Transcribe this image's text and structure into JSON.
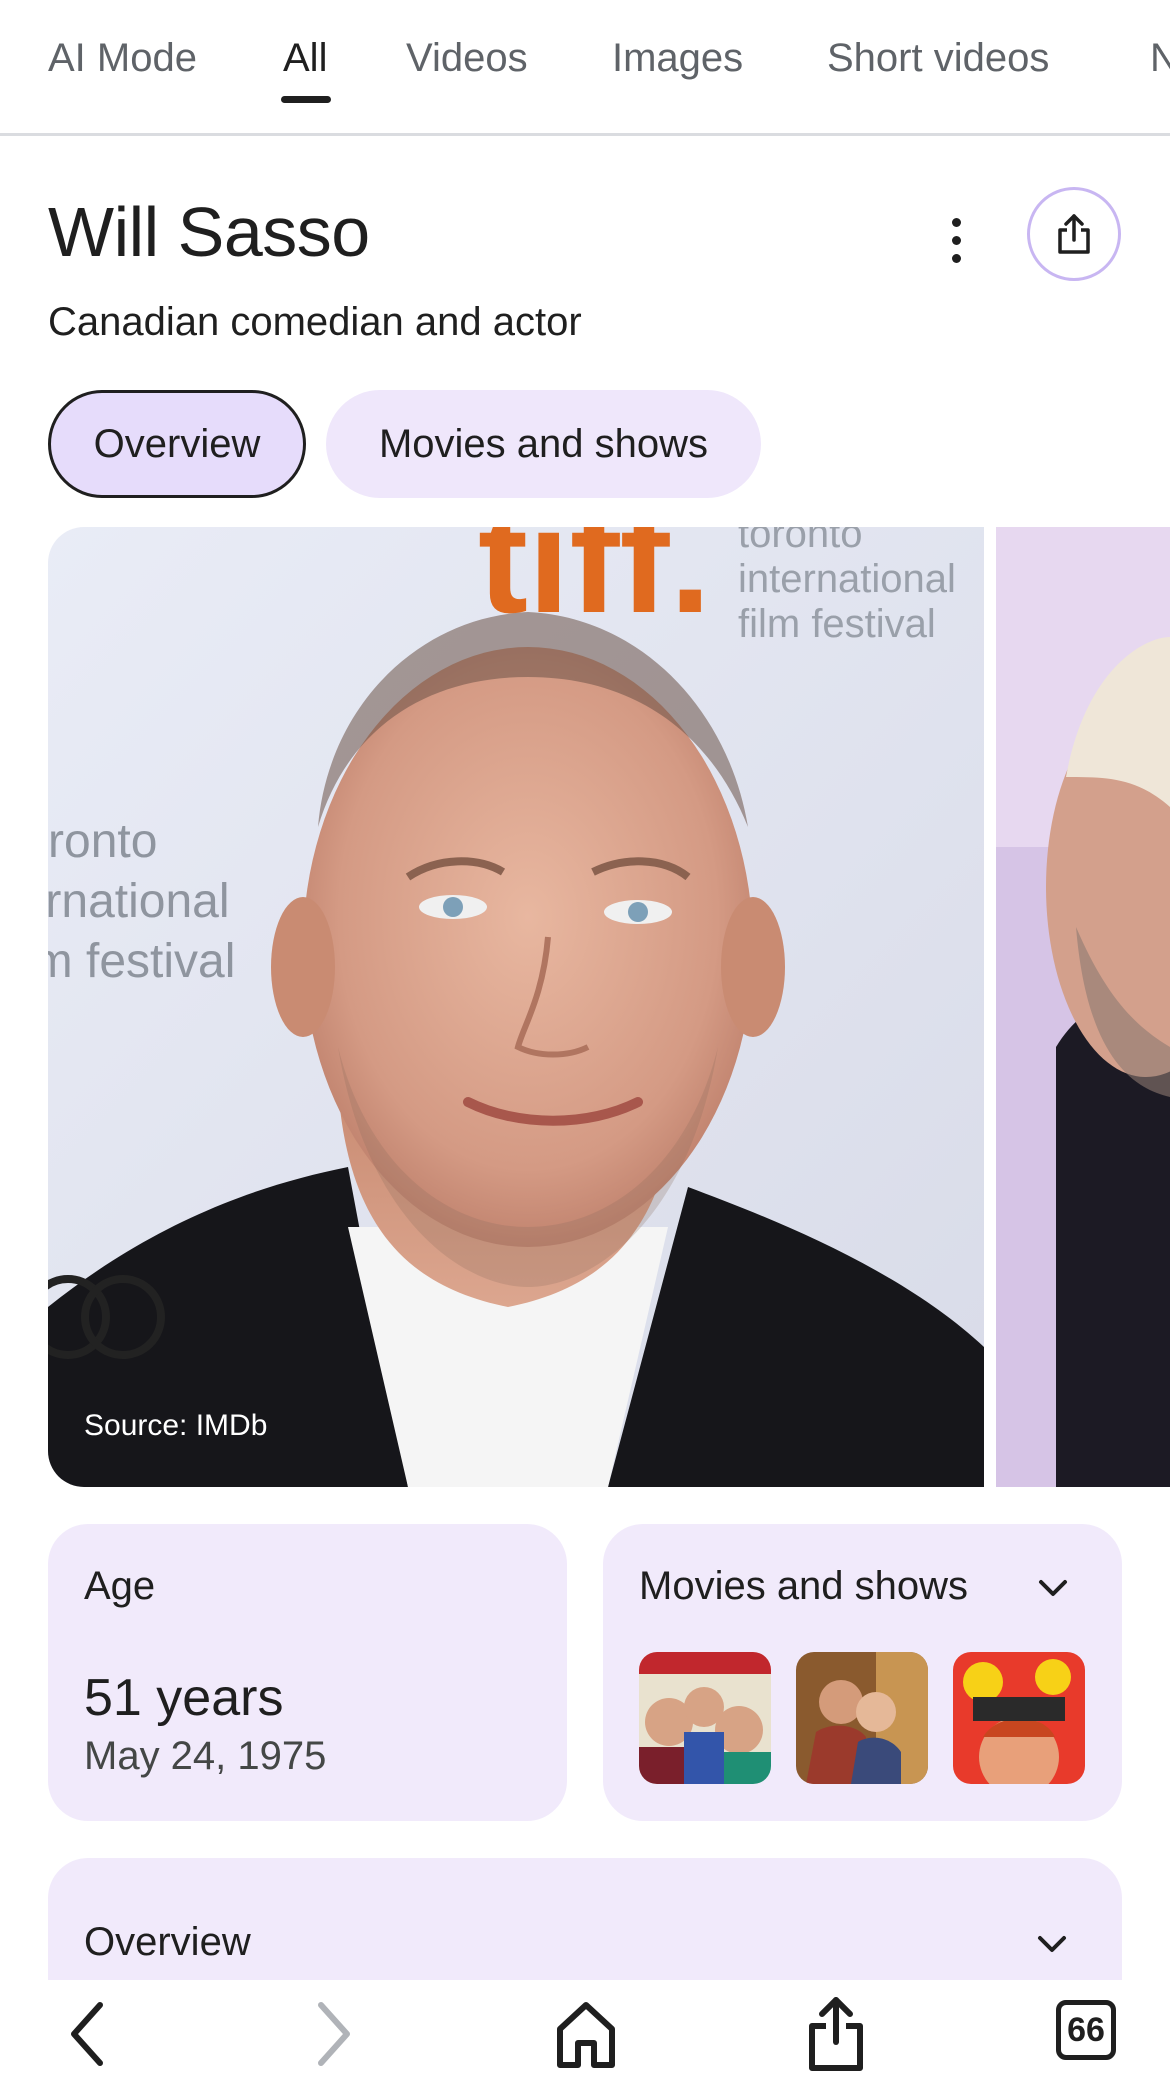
{
  "tabs": [
    {
      "label": "AI Mode",
      "active": false
    },
    {
      "label": "All",
      "active": true
    },
    {
      "label": "Videos",
      "active": false
    },
    {
      "label": "Images",
      "active": false
    },
    {
      "label": "Short videos",
      "active": false
    },
    {
      "label": "N",
      "active": false
    }
  ],
  "entity": {
    "name": "Will Sasso",
    "description": "Canadian comedian and actor"
  },
  "chips": [
    {
      "label": "Overview",
      "selected": true
    },
    {
      "label": "Movies and shows",
      "selected": false
    }
  ],
  "hero_image": {
    "source": "Source: IMDb",
    "backdrop_text": [
      "tiff.",
      "toronto",
      "international",
      "film festival"
    ]
  },
  "age_card": {
    "label": "Age",
    "value": "51 years",
    "date": "May 24, 1975"
  },
  "movies_card": {
    "label": "Movies and shows",
    "thumbnails": [
      "stooges-poster",
      "romance-still",
      "comic-poster"
    ]
  },
  "overview_card": {
    "label": "Overview"
  },
  "toolbar": {
    "tab_count": "66",
    "icons": [
      "back-icon",
      "forward-icon",
      "home-icon",
      "share-icon",
      "tabs-icon"
    ]
  },
  "colors": {
    "accent_chip": "#efe7fb",
    "card_bg": "#f1eafb",
    "share_ring": "#c8b6f2",
    "text": "#1f1f1f"
  }
}
